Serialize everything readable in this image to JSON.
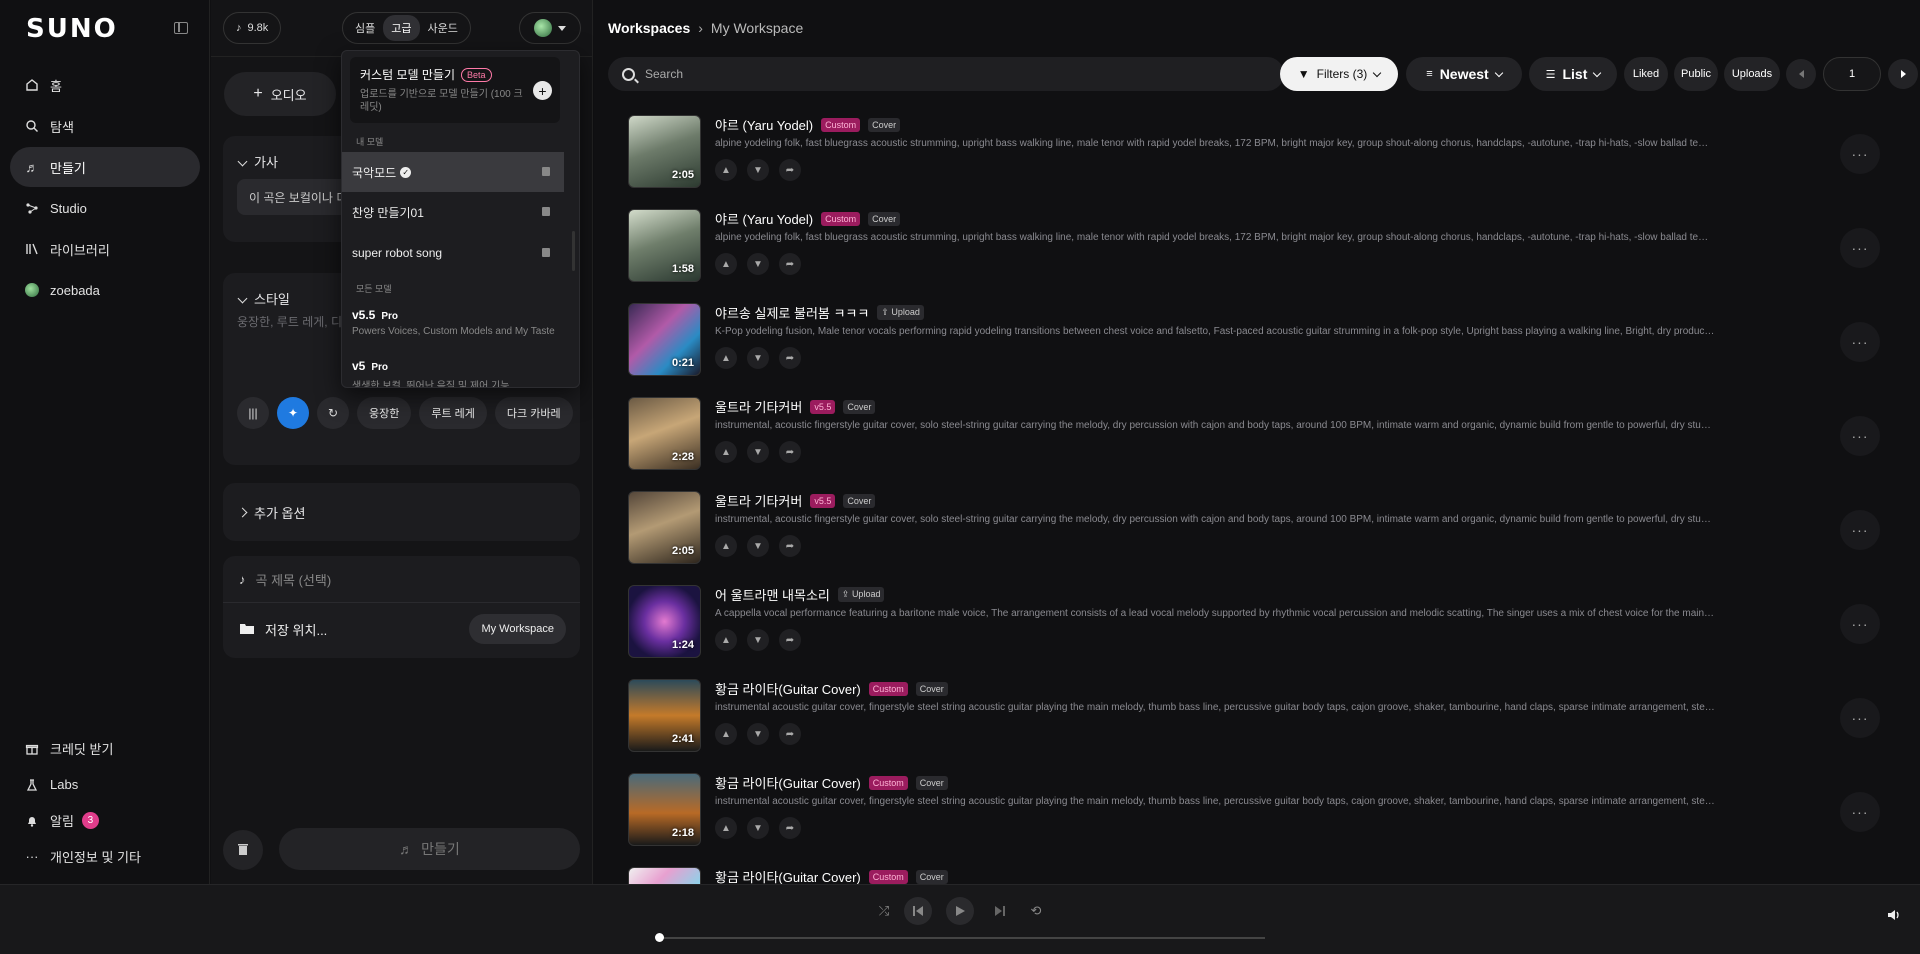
{
  "sidebar": {
    "logo": "SUNO",
    "items": [
      {
        "label": "홈",
        "icon": "home-icon"
      },
      {
        "label": "탐색",
        "icon": "search-icon"
      },
      {
        "label": "만들기",
        "icon": "music-note-icon",
        "active": true
      },
      {
        "label": "Studio",
        "icon": "studio-icon"
      },
      {
        "label": "라이브러리",
        "icon": "library-icon"
      },
      {
        "label": "zoebada",
        "icon": "avatar"
      }
    ],
    "bottom": [
      {
        "label": "크레딧 받기",
        "icon": "gift-icon"
      },
      {
        "label": "Labs",
        "icon": "flask-icon"
      },
      {
        "label": "알림",
        "icon": "bell-icon",
        "badge": "3"
      },
      {
        "label": "개인정보 및 기타",
        "icon": "more-icon"
      }
    ]
  },
  "create": {
    "credits": "9.8k",
    "modes": [
      "심플",
      "고급",
      "사운드"
    ],
    "active_mode": "고급",
    "audio_label": "오디오",
    "lyrics_label": "가사",
    "lyrics_value": "이 곡은 보컬이나 디",
    "style_label": "스타일",
    "style_placeholder": "웅장한, 루트 레게, 디",
    "style_chips": [
      "웅장한",
      "루트 레게",
      "다크 카바레"
    ],
    "more_options": "추가 옵션",
    "song_title_placeholder": "곡 제목 (선택)",
    "save_location_label": "저장 위치...",
    "workspace_pill": "My Workspace",
    "make_label": "만들기"
  },
  "model_dropdown": {
    "custom_title": "커스텀 모델 만들기",
    "beta": "Beta",
    "custom_desc": "업로드를 기반으로 모델 만들기 (100 크레딧)",
    "my_models_label": "내 모델",
    "my_models": [
      {
        "name": "국악모드",
        "selected": true
      },
      {
        "name": "찬양 만들기01",
        "selected": false
      },
      {
        "name": "super robot song",
        "selected": false
      }
    ],
    "all_models_label": "모든 모델",
    "models": [
      {
        "name": "v5.5",
        "tier": "Pro",
        "desc": "Powers Voices, Custom Models and My Taste"
      },
      {
        "name": "v5",
        "tier": "Pro",
        "desc": "생생한 보컬, 뛰어난 음질 및 제어 기능"
      }
    ]
  },
  "main": {
    "breadcrumb": {
      "root": "Workspaces",
      "current": "My Workspace"
    },
    "search_placeholder": "Search",
    "filters": "Filters (3)",
    "sort": "Newest",
    "view": "List",
    "liked": "Liked",
    "public": "Public",
    "uploads": "Uploads",
    "page": "1"
  },
  "songs": [
    {
      "title": "야르 (Yaru Yodel)",
      "tags": [
        "Custom",
        "Cover"
      ],
      "duration": "2:05",
      "desc": "alpine yodeling folk, fast bluegrass acoustic strumming, upright bass walking line, male tenor with rapid yodel breaks, 172 BPM, bright major key, group shout-along chorus, handclaps, -autotune, -trap hi-hats, -slow ballad tempo, -heavy"
    },
    {
      "title": "야르 (Yaru Yodel)",
      "tags": [
        "Custom",
        "Cover"
      ],
      "duration": "1:58",
      "desc": "alpine yodeling folk, fast bluegrass acoustic strumming, upright bass walking line, male tenor with rapid yodel breaks, 172 BPM, bright major key, group shout-along chorus, handclaps, -autotune, -trap hi-hats, -slow ballad tempo, -heavy"
    },
    {
      "title": "야르송 실제로 불러봄 ㅋㅋㅋ",
      "tags": [
        "Upload"
      ],
      "duration": "0:21",
      "desc": "K-Pop yodeling fusion, Male tenor vocals performing rapid yodeling transitions between chest voice and falsetto, Fast-paced acoustic guitar strumming in a folk-pop style, Upright bass playing a walking line, Bright, dry production with"
    },
    {
      "title": "울트라 기타커버",
      "tags": [
        "v5.5",
        "Cover"
      ],
      "duration": "2:28",
      "desc": "instrumental, acoustic fingerstyle guitar cover, solo steel-string guitar carrying the melody, dry percussion with cajon and body taps, around 100 BPM, intimate warm and organic, dynamic build from gentle to powerful, dry studio sound"
    },
    {
      "title": "울트라 기타커버",
      "tags": [
        "v5.5",
        "Cover"
      ],
      "duration": "2:05",
      "desc": "instrumental, acoustic fingerstyle guitar cover, solo steel-string guitar carrying the melody, dry percussion with cajon and body taps, around 100 BPM, intimate warm and organic, dynamic build from gentle to powerful, dry studio sound"
    },
    {
      "title": "어 울트라맨 내목소리",
      "tags": [
        "Upload"
      ],
      "duration": "1:24",
      "desc": "A cappella vocal performance featuring a baritone male voice, The arrangement consists of a lead vocal melody supported by rhythmic vocal percussion and melodic scatting, The singer uses a mix of chest voice for the main lyrics and"
    },
    {
      "title": "황금 라이타(Guitar Cover)",
      "tags": [
        "Custom",
        "Cover"
      ],
      "duration": "2:41",
      "desc": "instrumental acoustic guitar cover, fingerstyle steel string acoustic guitar playing the main melody, thumb bass line, percussive guitar body taps, cajon groove, shaker, tambourine, hand claps, sparse intimate arrangement, steady mar"
    },
    {
      "title": "황금 라이타(Guitar Cover)",
      "tags": [
        "Custom",
        "Cover"
      ],
      "duration": "2:18",
      "desc": "instrumental acoustic guitar cover, fingerstyle steel string acoustic guitar playing the main melody, thumb bass line, percussive guitar body taps, cajon groove, shaker, tambourine, hand claps, sparse intimate arrangement, steady mar"
    },
    {
      "title": "황금 라이타(Guitar Cover)",
      "tags": [
        "Custom",
        "Cover"
      ],
      "duration": "",
      "desc": ""
    }
  ],
  "colors": {
    "accent_blue": "#1f7ae0",
    "custom_tag": "#9b1c5e",
    "badge": "#e03d8b"
  }
}
